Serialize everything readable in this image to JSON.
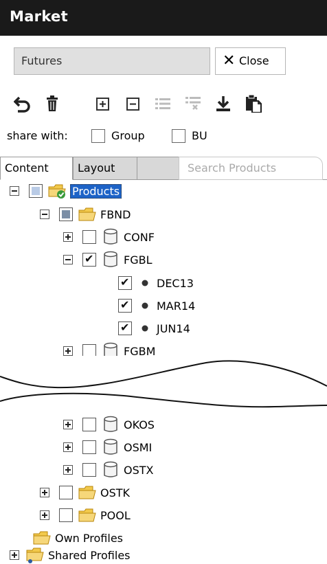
{
  "window": {
    "title": "Market"
  },
  "filter": {
    "value": "Futures"
  },
  "close_button": {
    "label": "Close"
  },
  "toolbar": {
    "icons": [
      "undo-icon",
      "trash-icon",
      "expand-all-icon",
      "collapse-all-icon",
      "list-icon",
      "list-filter-icon",
      "download-icon",
      "paste-icon"
    ]
  },
  "share": {
    "label": "share with:",
    "group_label": "Group",
    "bu_label": "BU"
  },
  "tabs": [
    {
      "label": "Content"
    },
    {
      "label": "Layout"
    }
  ],
  "search_products": {
    "placeholder": "Search Products"
  },
  "tree": {
    "root": "Products",
    "fbnd": "FBND",
    "conf": "CONF",
    "fgbl": "FGBL",
    "dec13": "DEC13",
    "mar14": "MAR14",
    "jun14": "JUN14",
    "fgbm": "FGBM",
    "okos": "OKOS",
    "osmi": "OSMI",
    "ostx": "OSTX",
    "ostk": "OSTK",
    "pool": "POOL",
    "own_profiles": "Own Profiles",
    "shared_profiles": "Shared Profiles"
  }
}
